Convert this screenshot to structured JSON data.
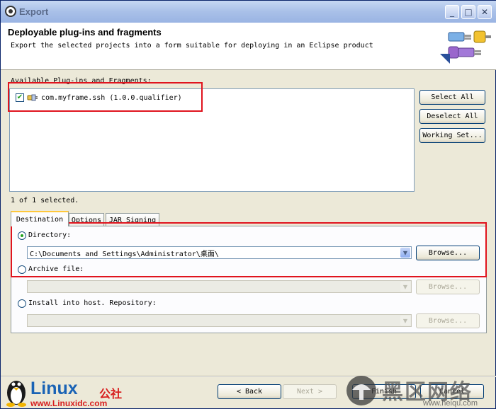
{
  "window": {
    "title": "Export",
    "minimize": "_",
    "maximize": "□",
    "close": "✕"
  },
  "header": {
    "title": "Deployable plug-ins and fragments",
    "description": "Export the selected projects into a form suitable for deploying in an Eclipse product"
  },
  "plugins": {
    "label": "Available Plug-ins and Fragments:",
    "items": [
      {
        "label": "com.myframe.ssh (1.0.0.qualifier)",
        "checked": true
      }
    ],
    "status": "1 of 1 selected."
  },
  "side_buttons": {
    "select_all": "Select All",
    "deselect_all": "Deselect All",
    "working_set": "Working Set..."
  },
  "tabs": [
    {
      "label": "Destination",
      "active": true
    },
    {
      "label": "Options"
    },
    {
      "label": "JAR Signing"
    }
  ],
  "destination": {
    "directory_label": "Directory:",
    "directory_value": "C:\\Documents and Settings\\Administrator\\桌面\\",
    "archive_label": "Archive file:",
    "archive_value": "",
    "install_label": "Install into host. Repository:",
    "install_value": "",
    "browse": "Browse...",
    "selected": "directory"
  },
  "footer": {
    "back": "< Back",
    "next": "Next >",
    "finish": "Finish",
    "cancel": "Cancel"
  },
  "watermark": {
    "logo_text": "Linux",
    "logo_cn": "公社",
    "url": "www.Linuxidc.com",
    "cn_brand": "黑区网络",
    "cn_url": "www.heiqu.com"
  },
  "colors": {
    "highlight_box": "#e0141e",
    "title_bar": "#a9c0e8",
    "dialog_bg": "#ece9d8"
  }
}
